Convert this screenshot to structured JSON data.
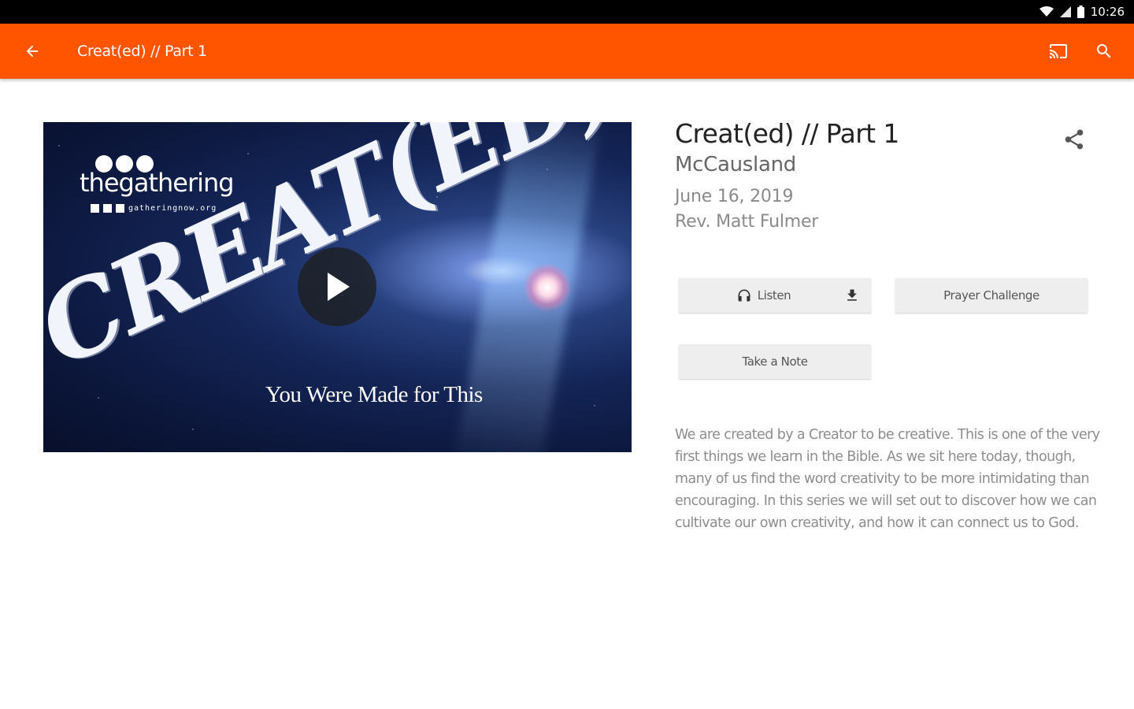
{
  "status_bar": {
    "time": "10:26",
    "icons": [
      "wifi-icon",
      "signal-icon",
      "battery-icon"
    ]
  },
  "app_bar": {
    "title": "Creat(ed) // Part 1",
    "background": "#ff5500",
    "icons": [
      "back-arrow-icon",
      "cast-icon",
      "search-icon"
    ]
  },
  "media": {
    "brand": "thegathering",
    "url": "gatheringnow.org",
    "artwork_title": "CREAT(ED)",
    "tagline": "You Were Made for This",
    "play_icon": "play-icon"
  },
  "sermon": {
    "title": "Creat(ed) // Part 1",
    "series": "McCausland",
    "date": "June 16, 2019",
    "speaker": "Rev. Matt Fulmer",
    "share_icon": "share-icon"
  },
  "actions": {
    "listen_label": "Listen",
    "prayer_label": "Prayer Challenge",
    "note_label": "Take a Note"
  },
  "description": "We are created by a Creator to be creative. This is one of the very first things we learn in the Bible. As we sit here today, though, many of us find the word creativity to be more intimidating than encouraging. In this series we will set out to discover how we can cultivate our own creativity, and how it can connect us to God."
}
